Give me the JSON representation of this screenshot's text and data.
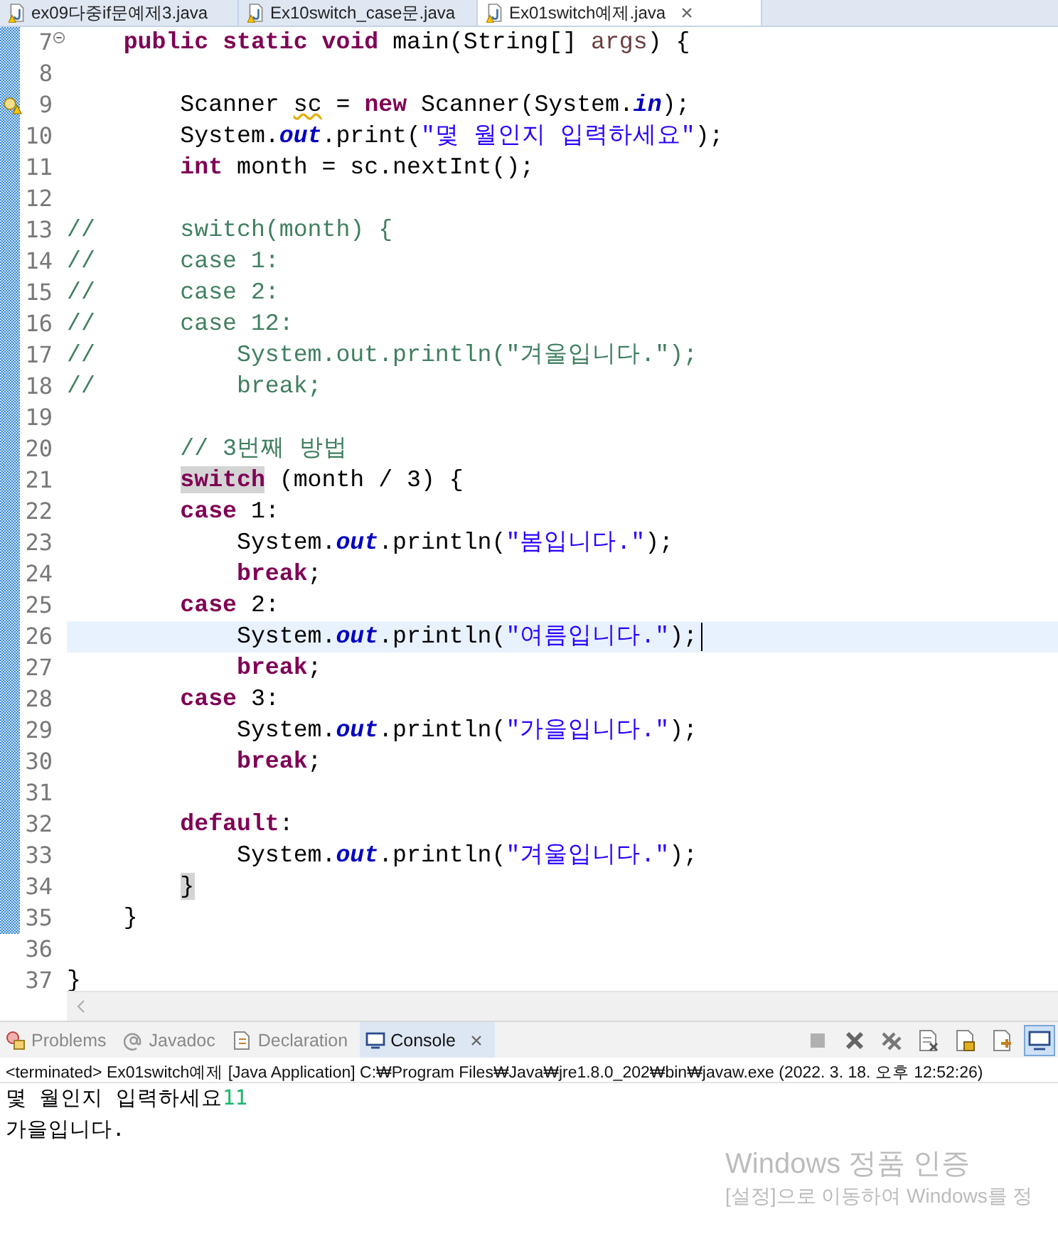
{
  "editor_tabs": [
    {
      "label": "ex09다중if문예제3.java",
      "selected": false,
      "warning": true
    },
    {
      "label": "Ex10switch_case문.java",
      "selected": false,
      "warning": true
    },
    {
      "label": "Ex01switch예제.java",
      "selected": true,
      "warning": true
    }
  ],
  "code_lines": [
    {
      "number": "7",
      "kind": "fold",
      "changed": true,
      "current": false,
      "tokens": [
        {
          "kind": "keyword",
          "text": "    public "
        },
        {
          "kind": "keyword",
          "text": "static "
        },
        {
          "kind": "keyword",
          "text": "void"
        },
        {
          "kind": "plain",
          "text": " main(String[] "
        },
        {
          "kind": "param",
          "text": "args"
        },
        {
          "kind": "plain",
          "text": ") {"
        }
      ]
    },
    {
      "number": "8",
      "kind": "plain",
      "changed": true,
      "current": false
    },
    {
      "number": "9",
      "kind": "warning",
      "changed": true,
      "current": false,
      "tokens": [
        {
          "kind": "plain",
          "text": "        Scanner "
        },
        {
          "kind": "warning",
          "text": "sc"
        },
        {
          "kind": "plain",
          "text": " = "
        },
        {
          "kind": "keyword",
          "text": "new"
        },
        {
          "kind": "plain",
          "text": " Scanner(System."
        },
        {
          "kind": "field",
          "text": "in"
        },
        {
          "kind": "plain",
          "text": ");"
        }
      ]
    },
    {
      "number": "10",
      "kind": "plain",
      "changed": true,
      "current": false,
      "tokens": [
        {
          "kind": "plain",
          "text": "        System."
        },
        {
          "kind": "field",
          "text": "out"
        },
        {
          "kind": "plain",
          "text": ".print("
        },
        {
          "kind": "string",
          "text": "\"몇 월인지 입력하세요\""
        },
        {
          "kind": "plain",
          "text": ");"
        }
      ]
    },
    {
      "number": "11",
      "kind": "plain",
      "changed": true,
      "current": false,
      "tokens": [
        {
          "kind": "keyword",
          "text": "        int"
        },
        {
          "kind": "plain",
          "text": " month = sc.nextInt();"
        }
      ]
    },
    {
      "number": "12",
      "kind": "plain",
      "changed": true,
      "current": false
    },
    {
      "number": "13",
      "kind": "plain",
      "changed": true,
      "current": false,
      "tokens": [
        {
          "kind": "comment",
          "text": "//      switch(month) {"
        }
      ]
    },
    {
      "number": "14",
      "kind": "plain",
      "changed": true,
      "current": false,
      "tokens": [
        {
          "kind": "comment",
          "text": "//      case 1:"
        }
      ]
    },
    {
      "number": "15",
      "kind": "plain",
      "changed": true,
      "current": false,
      "tokens": [
        {
          "kind": "comment",
          "text": "//      case 2:"
        }
      ]
    },
    {
      "number": "16",
      "kind": "plain",
      "changed": true,
      "current": false,
      "tokens": [
        {
          "kind": "comment",
          "text": "//      case 12:"
        }
      ]
    },
    {
      "number": "17",
      "kind": "plain",
      "changed": true,
      "current": false,
      "tokens": [
        {
          "kind": "comment",
          "text": "//          System.out.println(\"겨울입니다.\");"
        }
      ]
    },
    {
      "number": "18",
      "kind": "plain",
      "changed": true,
      "current": false,
      "tokens": [
        {
          "kind": "comment",
          "text": "//          break;"
        }
      ]
    },
    {
      "number": "19",
      "kind": "plain",
      "changed": true,
      "current": false
    },
    {
      "number": "20",
      "kind": "plain",
      "changed": true,
      "current": false,
      "tokens": [
        {
          "kind": "comment",
          "text": "        // 3번째 방법"
        }
      ]
    },
    {
      "number": "21",
      "kind": "plain",
      "changed": true,
      "current": false,
      "tokens": [
        {
          "kind": "keyword_marked",
          "text": "        switch"
        },
        {
          "kind": "plain",
          "text": " (month / 3) {"
        }
      ]
    },
    {
      "number": "22",
      "kind": "plain",
      "changed": true,
      "current": false,
      "tokens": [
        {
          "kind": "keyword",
          "text": "        case"
        },
        {
          "kind": "plain",
          "text": " 1:"
        }
      ]
    },
    {
      "number": "23",
      "kind": "plain",
      "changed": true,
      "current": false,
      "tokens": [
        {
          "kind": "plain",
          "text": "            System."
        },
        {
          "kind": "field",
          "text": "out"
        },
        {
          "kind": "plain",
          "text": ".println("
        },
        {
          "kind": "string",
          "text": "\"봄입니다.\""
        },
        {
          "kind": "plain",
          "text": ");"
        }
      ]
    },
    {
      "number": "24",
      "kind": "plain",
      "changed": true,
      "current": false,
      "tokens": [
        {
          "kind": "keyword",
          "text": "            break"
        },
        {
          "kind": "plain",
          "text": ";"
        }
      ]
    },
    {
      "number": "25",
      "kind": "plain",
      "changed": true,
      "current": false,
      "tokens": [
        {
          "kind": "keyword",
          "text": "        case"
        },
        {
          "kind": "plain",
          "text": " 2:"
        }
      ]
    },
    {
      "number": "26",
      "kind": "plain",
      "changed": true,
      "current": true,
      "tokens": [
        {
          "kind": "plain",
          "text": "            System."
        },
        {
          "kind": "field",
          "text": "out"
        },
        {
          "kind": "plain",
          "text": ".println("
        },
        {
          "kind": "string",
          "text": "\"여름입니다.\""
        },
        {
          "kind": "plain",
          "text": ");"
        }
      ]
    },
    {
      "number": "27",
      "kind": "plain",
      "changed": true,
      "current": false,
      "tokens": [
        {
          "kind": "keyword",
          "text": "            break"
        },
        {
          "kind": "plain",
          "text": ";"
        }
      ]
    },
    {
      "number": "28",
      "kind": "plain",
      "changed": true,
      "current": false,
      "tokens": [
        {
          "kind": "keyword",
          "text": "        case"
        },
        {
          "kind": "plain",
          "text": " 3:"
        }
      ]
    },
    {
      "number": "29",
      "kind": "plain",
      "changed": true,
      "current": false,
      "tokens": [
        {
          "kind": "plain",
          "text": "            System."
        },
        {
          "kind": "field",
          "text": "out"
        },
        {
          "kind": "plain",
          "text": ".println("
        },
        {
          "kind": "string",
          "text": "\"가을입니다.\""
        },
        {
          "kind": "plain",
          "text": ");"
        }
      ]
    },
    {
      "number": "30",
      "kind": "plain",
      "changed": true,
      "current": false,
      "tokens": [
        {
          "kind": "keyword",
          "text": "            break"
        },
        {
          "kind": "plain",
          "text": ";"
        }
      ]
    },
    {
      "number": "31",
      "kind": "plain",
      "changed": true,
      "current": false
    },
    {
      "number": "32",
      "kind": "plain",
      "changed": true,
      "current": false,
      "tokens": [
        {
          "kind": "keyword",
          "text": "        default"
        },
        {
          "kind": "plain",
          "text": ":"
        }
      ]
    },
    {
      "number": "33",
      "kind": "plain",
      "changed": true,
      "current": false,
      "tokens": [
        {
          "kind": "plain",
          "text": "            System."
        },
        {
          "kind": "field",
          "text": "out"
        },
        {
          "kind": "plain",
          "text": ".println("
        },
        {
          "kind": "string",
          "text": "\"겨울입니다.\""
        },
        {
          "kind": "plain",
          "text": ");"
        }
      ]
    },
    {
      "number": "34",
      "kind": "plain",
      "changed": true,
      "current": false,
      "tokens": [
        {
          "kind": "bracket_marked",
          "text": "        }"
        }
      ]
    },
    {
      "number": "35",
      "kind": "plain",
      "changed": true,
      "current": false,
      "tokens": [
        {
          "kind": "plain",
          "text": "    }"
        }
      ]
    },
    {
      "number": "36",
      "kind": "plain",
      "changed": false,
      "current": false
    },
    {
      "number": "37",
      "kind": "plain",
      "changed": false,
      "current": false,
      "tokens": [
        {
          "kind": "plain",
          "text": "}"
        }
      ]
    }
  ],
  "view_tabs": [
    {
      "label": "Problems",
      "selected": false
    },
    {
      "label": "Javadoc",
      "selected": false
    },
    {
      "label": "Declaration",
      "selected": false
    },
    {
      "label": "Console",
      "selected": true
    }
  ],
  "console_toolbar": [
    {
      "selected": false
    },
    {
      "selected": false
    },
    {
      "selected": false
    },
    {
      "selected": false
    },
    {
      "selected": false
    },
    {
      "selected": false
    },
    {
      "selected": true
    }
  ],
  "console": {
    "process": "<terminated> Ex01switch예제 [Java Application] C:₩Program Files₩Java₩jre1.8.0_202₩bin₩javaw.exe (2022. 3. 18. 오후 12:52:26)",
    "output": [
      {
        "segments": [
          {
            "kind": "output",
            "text": "몇 월인지 입력하세요"
          },
          {
            "kind": "input",
            "text": "11"
          }
        ]
      },
      {
        "segments": [
          {
            "kind": "output",
            "text": "가을입니다."
          }
        ]
      }
    ]
  },
  "activation_notice": {
    "title": "Windows 정품 인증",
    "message": "[설정]으로 이동하여 Windows를 정"
  }
}
